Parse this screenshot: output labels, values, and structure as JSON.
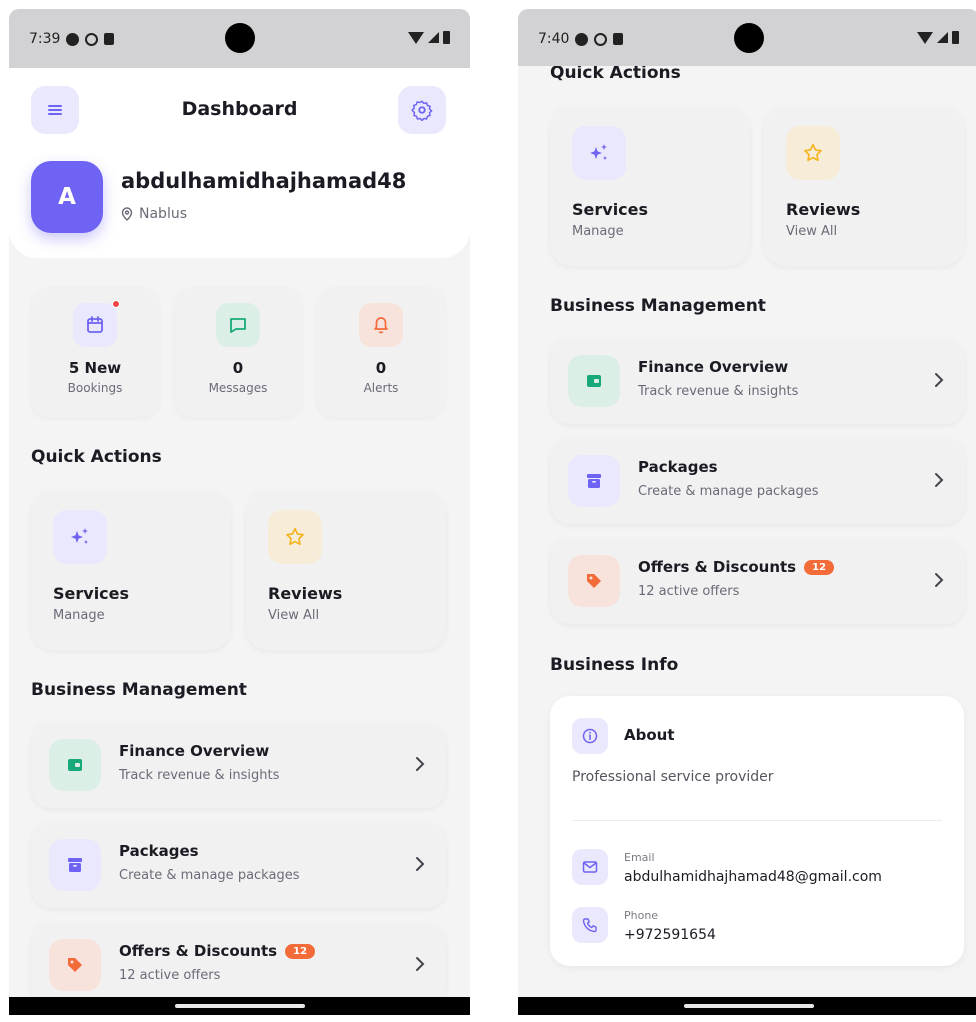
{
  "colors": {
    "primary": "#6e63f2",
    "primary_light": "#e9e8fc",
    "green": "#18a97a",
    "green_light": "#dcefe7",
    "orange": "#f26b38",
    "orange_light": "#f8e3dc",
    "yellow": "#f5b41e",
    "yellow_light": "#f7ecd7",
    "background": "#f4f4f5"
  },
  "screen1": {
    "status_time": "7:39",
    "header": {
      "title": "Dashboard",
      "menu_icon": "menu-icon",
      "settings_icon": "settings-icon"
    },
    "profile": {
      "avatar_letter": "A",
      "username": "abdulhamidhajhamad48",
      "location": "Nablus"
    },
    "stats": [
      {
        "value": "5 New",
        "label": "Bookings",
        "icon": "calendar-icon"
      },
      {
        "value": "0",
        "label": "Messages",
        "icon": "message-icon"
      },
      {
        "value": "0",
        "label": "Alerts",
        "icon": "bell-icon"
      }
    ],
    "quick_actions_title": "Quick Actions",
    "quick_actions": [
      {
        "title": "Services",
        "subtitle": "Manage",
        "icon": "sparkles-icon"
      },
      {
        "title": "Reviews",
        "subtitle": "View All",
        "icon": "star-icon"
      }
    ],
    "business_management_title": "Business Management",
    "management_items": [
      {
        "title": "Finance Overview",
        "subtitle": "Track revenue & insights",
        "icon": "wallet-icon"
      },
      {
        "title": "Packages",
        "subtitle": "Create & manage packages",
        "icon": "archive-icon"
      },
      {
        "title": "Offers & Discounts",
        "subtitle": "12 active offers",
        "badge": "12",
        "icon": "tag-icon"
      }
    ]
  },
  "screen2": {
    "status_time": "7:40",
    "quick_actions_title": "Quick Actions",
    "quick_actions": [
      {
        "title": "Services",
        "subtitle": "Manage",
        "icon": "sparkles-icon"
      },
      {
        "title": "Reviews",
        "subtitle": "View All",
        "icon": "star-icon"
      }
    ],
    "business_management_title": "Business Management",
    "management_items": [
      {
        "title": "Finance Overview",
        "subtitle": "Track revenue & insights",
        "icon": "wallet-icon"
      },
      {
        "title": "Packages",
        "subtitle": "Create & manage packages",
        "icon": "archive-icon"
      },
      {
        "title": "Offers & Discounts",
        "subtitle": "12 active offers",
        "badge": "12",
        "icon": "tag-icon"
      }
    ],
    "business_info_title": "Business Info",
    "about": {
      "title": "About",
      "text": "Professional service provider"
    },
    "email": {
      "label": "Email",
      "value": "abdulhamidhajhamad48@gmail.com"
    },
    "phone": {
      "label": "Phone",
      "value": "+972591654"
    }
  }
}
